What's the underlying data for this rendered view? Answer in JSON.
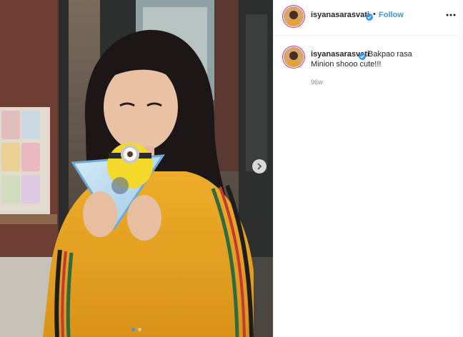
{
  "post": {
    "username": "isyanasarasvati",
    "verified": true,
    "separator": "•",
    "follow_label": "Follow",
    "caption_first": "Bakpao rasa",
    "caption_second": "Minion shooo cute!!!",
    "time_ago": "96w",
    "carousel": {
      "slides": 2,
      "active_index": 0
    }
  },
  "icons": {
    "verified": "verified-badge-icon",
    "more": "more-options-icon",
    "next": "chevron-right-icon"
  },
  "colors": {
    "link_blue": "#3897f0",
    "text": "#262626",
    "muted": "#8e8e8e",
    "sweater": "#e8a41f",
    "minion_yellow": "#f5d92a"
  }
}
